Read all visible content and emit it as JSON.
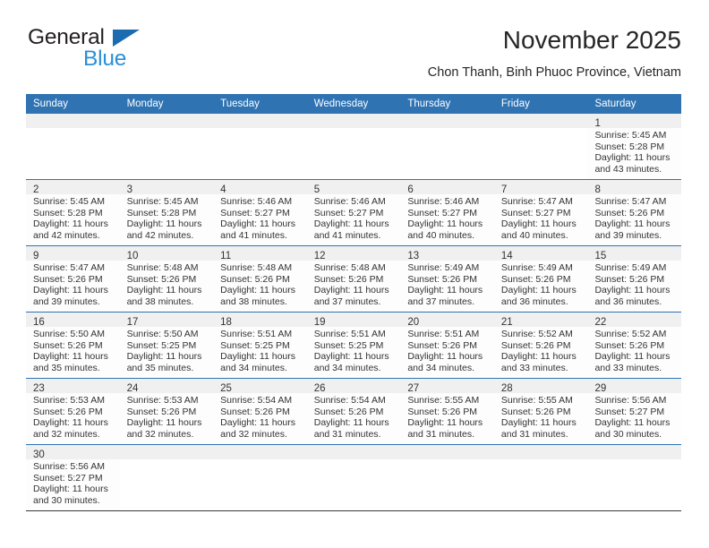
{
  "brand": {
    "line1": "General",
    "line2": "Blue",
    "flag_color": "#1b6bb0",
    "blue_text_color": "#2b8fd6"
  },
  "header": {
    "title": "November 2025",
    "subtitle": "Chon Thanh, Binh Phuoc Province, Vietnam"
  },
  "theme": {
    "header_blue": "#2f73b3",
    "day_band_gray": "#f0f0f0",
    "text_color": "#333333"
  },
  "calendar": {
    "weekdays": [
      "Sunday",
      "Monday",
      "Tuesday",
      "Wednesday",
      "Thursday",
      "Friday",
      "Saturday"
    ],
    "weeks": [
      [
        {
          "day": "",
          "lines": []
        },
        {
          "day": "",
          "lines": []
        },
        {
          "day": "",
          "lines": []
        },
        {
          "day": "",
          "lines": []
        },
        {
          "day": "",
          "lines": []
        },
        {
          "day": "",
          "lines": []
        },
        {
          "day": "1",
          "lines": [
            "Sunrise: 5:45 AM",
            "Sunset: 5:28 PM",
            "Daylight: 11 hours",
            "and 43 minutes."
          ]
        }
      ],
      [
        {
          "day": "2",
          "lines": [
            "Sunrise: 5:45 AM",
            "Sunset: 5:28 PM",
            "Daylight: 11 hours",
            "and 42 minutes."
          ]
        },
        {
          "day": "3",
          "lines": [
            "Sunrise: 5:45 AM",
            "Sunset: 5:28 PM",
            "Daylight: 11 hours",
            "and 42 minutes."
          ]
        },
        {
          "day": "4",
          "lines": [
            "Sunrise: 5:46 AM",
            "Sunset: 5:27 PM",
            "Daylight: 11 hours",
            "and 41 minutes."
          ]
        },
        {
          "day": "5",
          "lines": [
            "Sunrise: 5:46 AM",
            "Sunset: 5:27 PM",
            "Daylight: 11 hours",
            "and 41 minutes."
          ]
        },
        {
          "day": "6",
          "lines": [
            "Sunrise: 5:46 AM",
            "Sunset: 5:27 PM",
            "Daylight: 11 hours",
            "and 40 minutes."
          ]
        },
        {
          "day": "7",
          "lines": [
            "Sunrise: 5:47 AM",
            "Sunset: 5:27 PM",
            "Daylight: 11 hours",
            "and 40 minutes."
          ]
        },
        {
          "day": "8",
          "lines": [
            "Sunrise: 5:47 AM",
            "Sunset: 5:26 PM",
            "Daylight: 11 hours",
            "and 39 minutes."
          ]
        }
      ],
      [
        {
          "day": "9",
          "lines": [
            "Sunrise: 5:47 AM",
            "Sunset: 5:26 PM",
            "Daylight: 11 hours",
            "and 39 minutes."
          ]
        },
        {
          "day": "10",
          "lines": [
            "Sunrise: 5:48 AM",
            "Sunset: 5:26 PM",
            "Daylight: 11 hours",
            "and 38 minutes."
          ]
        },
        {
          "day": "11",
          "lines": [
            "Sunrise: 5:48 AM",
            "Sunset: 5:26 PM",
            "Daylight: 11 hours",
            "and 38 minutes."
          ]
        },
        {
          "day": "12",
          "lines": [
            "Sunrise: 5:48 AM",
            "Sunset: 5:26 PM",
            "Daylight: 11 hours",
            "and 37 minutes."
          ]
        },
        {
          "day": "13",
          "lines": [
            "Sunrise: 5:49 AM",
            "Sunset: 5:26 PM",
            "Daylight: 11 hours",
            "and 37 minutes."
          ]
        },
        {
          "day": "14",
          "lines": [
            "Sunrise: 5:49 AM",
            "Sunset: 5:26 PM",
            "Daylight: 11 hours",
            "and 36 minutes."
          ]
        },
        {
          "day": "15",
          "lines": [
            "Sunrise: 5:49 AM",
            "Sunset: 5:26 PM",
            "Daylight: 11 hours",
            "and 36 minutes."
          ]
        }
      ],
      [
        {
          "day": "16",
          "lines": [
            "Sunrise: 5:50 AM",
            "Sunset: 5:26 PM",
            "Daylight: 11 hours",
            "and 35 minutes."
          ]
        },
        {
          "day": "17",
          "lines": [
            "Sunrise: 5:50 AM",
            "Sunset: 5:25 PM",
            "Daylight: 11 hours",
            "and 35 minutes."
          ]
        },
        {
          "day": "18",
          "lines": [
            "Sunrise: 5:51 AM",
            "Sunset: 5:25 PM",
            "Daylight: 11 hours",
            "and 34 minutes."
          ]
        },
        {
          "day": "19",
          "lines": [
            "Sunrise: 5:51 AM",
            "Sunset: 5:25 PM",
            "Daylight: 11 hours",
            "and 34 minutes."
          ]
        },
        {
          "day": "20",
          "lines": [
            "Sunrise: 5:51 AM",
            "Sunset: 5:26 PM",
            "Daylight: 11 hours",
            "and 34 minutes."
          ]
        },
        {
          "day": "21",
          "lines": [
            "Sunrise: 5:52 AM",
            "Sunset: 5:26 PM",
            "Daylight: 11 hours",
            "and 33 minutes."
          ]
        },
        {
          "day": "22",
          "lines": [
            "Sunrise: 5:52 AM",
            "Sunset: 5:26 PM",
            "Daylight: 11 hours",
            "and 33 minutes."
          ]
        }
      ],
      [
        {
          "day": "23",
          "lines": [
            "Sunrise: 5:53 AM",
            "Sunset: 5:26 PM",
            "Daylight: 11 hours",
            "and 32 minutes."
          ]
        },
        {
          "day": "24",
          "lines": [
            "Sunrise: 5:53 AM",
            "Sunset: 5:26 PM",
            "Daylight: 11 hours",
            "and 32 minutes."
          ]
        },
        {
          "day": "25",
          "lines": [
            "Sunrise: 5:54 AM",
            "Sunset: 5:26 PM",
            "Daylight: 11 hours",
            "and 32 minutes."
          ]
        },
        {
          "day": "26",
          "lines": [
            "Sunrise: 5:54 AM",
            "Sunset: 5:26 PM",
            "Daylight: 11 hours",
            "and 31 minutes."
          ]
        },
        {
          "day": "27",
          "lines": [
            "Sunrise: 5:55 AM",
            "Sunset: 5:26 PM",
            "Daylight: 11 hours",
            "and 31 minutes."
          ]
        },
        {
          "day": "28",
          "lines": [
            "Sunrise: 5:55 AM",
            "Sunset: 5:26 PM",
            "Daylight: 11 hours",
            "and 31 minutes."
          ]
        },
        {
          "day": "29",
          "lines": [
            "Sunrise: 5:56 AM",
            "Sunset: 5:27 PM",
            "Daylight: 11 hours",
            "and 30 minutes."
          ]
        }
      ],
      [
        {
          "day": "30",
          "lines": [
            "Sunrise: 5:56 AM",
            "Sunset: 5:27 PM",
            "Daylight: 11 hours",
            "and 30 minutes."
          ]
        },
        {
          "day": "",
          "lines": []
        },
        {
          "day": "",
          "lines": []
        },
        {
          "day": "",
          "lines": []
        },
        {
          "day": "",
          "lines": []
        },
        {
          "day": "",
          "lines": []
        },
        {
          "day": "",
          "lines": []
        }
      ]
    ]
  }
}
